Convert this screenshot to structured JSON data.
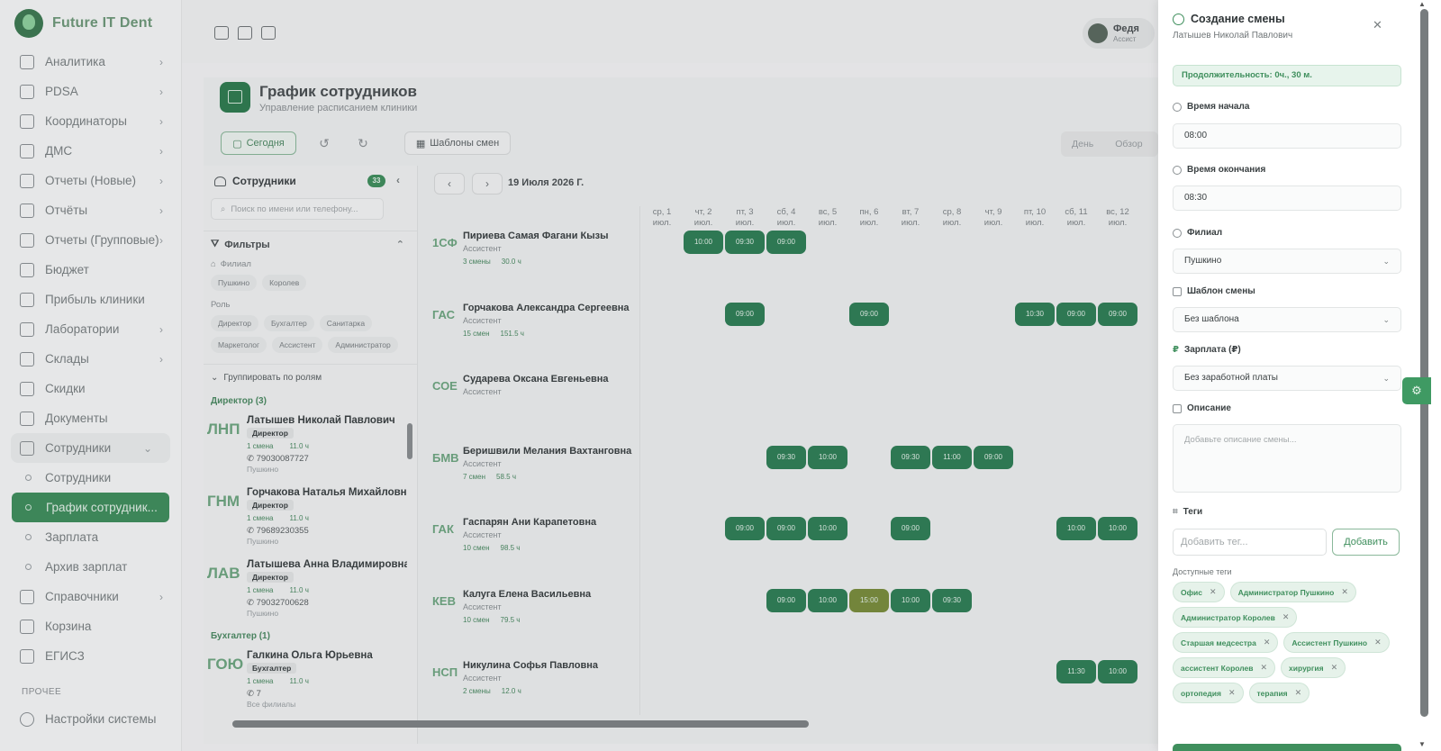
{
  "app": {
    "name": "Future IT Dent"
  },
  "sidebar": {
    "items": [
      {
        "label": "Аналитика",
        "chevron": true
      },
      {
        "label": "PDSA",
        "chevron": true
      },
      {
        "label": "Координаторы",
        "chevron": true
      },
      {
        "label": "ДМС",
        "chevron": true
      },
      {
        "label": "Отчеты (Новые)",
        "chevron": true
      },
      {
        "label": "Отчёты",
        "chevron": true
      },
      {
        "label": "Отчеты (Групповые)",
        "chevron": true
      },
      {
        "label": "Бюджет",
        "chevron": false
      },
      {
        "label": "Прибыль клиники",
        "chevron": false
      },
      {
        "label": "Лаборатории",
        "chevron": true
      },
      {
        "label": "Склады",
        "chevron": true
      },
      {
        "label": "Скидки",
        "chevron": false
      },
      {
        "label": "Документы",
        "chevron": false
      },
      {
        "label": "Сотрудники",
        "chevron": true
      }
    ],
    "sub_items": [
      "Сотрудники",
      "График сотрудник...",
      "Зарплата",
      "Архив зарплат"
    ],
    "items_after": [
      {
        "label": "Справочники",
        "chevron": true
      },
      {
        "label": "Корзина",
        "chevron": false
      },
      {
        "label": "ЕГИСЗ",
        "chevron": false
      }
    ],
    "section_other": "ПРОЧЕЕ",
    "settings_label": "Настройки системы"
  },
  "topbar": {
    "user_name": "Федя",
    "user_role": "Ассист"
  },
  "page": {
    "title": "График сотрудников",
    "subtitle": "Управление расписанием клиники"
  },
  "toolbar": {
    "today": "Сегодня",
    "templates": "Шаблоны смен",
    "view_day": "День",
    "view_overview": "Обзор"
  },
  "employees": {
    "title": "Сотрудники",
    "count": "33",
    "search_placeholder": "Поиск по имени или телефону...",
    "filters_title": "Фильтры",
    "filter_branch_label": "Филиал",
    "branches": [
      "Пушкино",
      "Королев"
    ],
    "filter_role_label": "Роль",
    "roles": [
      "Директор",
      "Бухгалтер",
      "Санитарка",
      "Маркетолог",
      "Ассистент",
      "Администратор"
    ],
    "group_by_roles": "Группировать по ролям",
    "groups": [
      {
        "label": "Директор (3)",
        "people": [
          {
            "initials": "ЛНП",
            "name": "Латышев Николай Павлович",
            "role": "Директор",
            "shifts": "1 смена",
            "hours": "11.0 ч",
            "phone": "79030087727",
            "branch": "Пушкино"
          },
          {
            "initials": "ГНМ",
            "name": "Горчакова Наталья Михайловна",
            "role": "Директор",
            "shifts": "1 смена",
            "hours": "11.0 ч",
            "phone": "79689230355",
            "branch": "Пушкино"
          },
          {
            "initials": "ЛАВ",
            "name": "Латышева Анна Владимировна",
            "role": "Директор",
            "shifts": "1 смена",
            "hours": "11.0 ч",
            "phone": "79032700628",
            "branch": "Пушкино"
          }
        ]
      },
      {
        "label": "Бухгалтер (1)",
        "people": [
          {
            "initials": "ГОЮ",
            "name": "Галкина Ольга Юрьевна",
            "role": "Бухгалтер",
            "shifts": "1 смена",
            "hours": "11.0 ч",
            "phone": "7",
            "branch": "Все филиалы"
          }
        ]
      }
    ]
  },
  "calendar": {
    "date": "19 Июля 2026 Г.",
    "days": [
      {
        "d": "ср, 1",
        "m": "июл."
      },
      {
        "d": "чт, 2",
        "m": "июл."
      },
      {
        "d": "пт, 3",
        "m": "июл."
      },
      {
        "d": "сб, 4",
        "m": "июл."
      },
      {
        "d": "вс, 5",
        "m": "июл."
      },
      {
        "d": "пн, 6",
        "m": "июл."
      },
      {
        "d": "вт, 7",
        "m": "июл."
      },
      {
        "d": "ср, 8",
        "m": "июл."
      },
      {
        "d": "чт, 9",
        "m": "июл."
      },
      {
        "d": "пт, 10",
        "m": "июл."
      },
      {
        "d": "сб, 11",
        "m": "июл."
      },
      {
        "d": "вс, 12",
        "m": "июл."
      }
    ],
    "rows": [
      {
        "initials": "1СФ",
        "name": "Пириева Самая Фагани Кызы",
        "role": "Ассистент",
        "shifts": "3 смены",
        "hours": "30.0 ч",
        "entries": [
          {
            "day": 1,
            "time": "10:00"
          },
          {
            "day": 2,
            "time": "09:30"
          },
          {
            "day": 3,
            "time": "09:00"
          }
        ]
      },
      {
        "initials": "ГАС",
        "name": "Горчакова Александра Сергеевна",
        "role": "Ассистент",
        "shifts": "15 смен",
        "hours": "151.5 ч",
        "entries": [
          {
            "day": 2,
            "time": "09:00"
          },
          {
            "day": 5,
            "time": "09:00"
          },
          {
            "day": 9,
            "time": "10:30"
          },
          {
            "day": 10,
            "time": "09:00"
          },
          {
            "day": 11,
            "time": "09:00"
          }
        ]
      },
      {
        "initials": "СОЕ",
        "name": "Сударева Оксана Евгеньевна",
        "role": "Ассистент",
        "shifts": "",
        "hours": "",
        "entries": []
      },
      {
        "initials": "БМВ",
        "name": "Беришвили Мелания Вахтанговна",
        "role": "Ассистент",
        "shifts": "7 смен",
        "hours": "58.5 ч",
        "entries": [
          {
            "day": 3,
            "time": "09:30"
          },
          {
            "day": 4,
            "time": "10:00"
          },
          {
            "day": 6,
            "time": "09:30"
          },
          {
            "day": 7,
            "time": "11:00"
          },
          {
            "day": 8,
            "time": "09:00"
          }
        ]
      },
      {
        "initials": "ГАК",
        "name": "Гаспарян Ани Карапетовна",
        "role": "Ассистент",
        "shifts": "10 смен",
        "hours": "98.5 ч",
        "entries": [
          {
            "day": 2,
            "time": "09:00"
          },
          {
            "day": 3,
            "time": "09:00"
          },
          {
            "day": 4,
            "time": "10:00"
          },
          {
            "day": 6,
            "time": "09:00"
          },
          {
            "day": 10,
            "time": "10:00"
          },
          {
            "day": 11,
            "time": "10:00"
          }
        ]
      },
      {
        "initials": "КЕВ",
        "name": "Калуга Елена Васильевна",
        "role": "Ассистент",
        "shifts": "10 смен",
        "hours": "79.5 ч",
        "entries": [
          {
            "day": 3,
            "time": "09:00"
          },
          {
            "day": 4,
            "time": "10:00"
          },
          {
            "day": 5,
            "time": "15:00",
            "warn": true
          },
          {
            "day": 6,
            "time": "10:00"
          },
          {
            "day": 7,
            "time": "09:30"
          }
        ]
      },
      {
        "initials": "НСП",
        "name": "Никулина Софья Павловна",
        "role": "Ассистент",
        "shifts": "2 смены",
        "hours": "12.0 ч",
        "entries": [
          {
            "day": 10,
            "time": "11:30"
          },
          {
            "day": 11,
            "time": "10:00"
          }
        ]
      }
    ]
  },
  "drawer": {
    "title": "Создание смены",
    "subtitle": "Латышев Николай Павлович",
    "duration": "Продолжительность: 0ч., 30 м.",
    "start_label": "Время начала",
    "start_value": "08:00",
    "end_label": "Время окончания",
    "end_value": "08:30",
    "branch_label": "Филиал",
    "branch_value": "Пушкино",
    "template_label": "Шаблон смены",
    "template_value": "Без шаблона",
    "salary_label": "Зарплата (₽)",
    "salary_value": "Без заработной платы",
    "description_label": "Описание",
    "description_placeholder": "Добавьте описание смены...",
    "tags_label": "Теги",
    "tag_input_placeholder": "Добавить тег...",
    "add_button": "Добавить",
    "available_tags_label": "Доступные теги",
    "tags": [
      "Офис",
      "Администратор Пушкино",
      "Администратор Королев",
      "Старшая медсестра",
      "Ассистент Пушкино",
      "ассистент Королев",
      "хирургия",
      "ортопедия",
      "терапия"
    ]
  },
  "icons": {
    "close": "close-icon",
    "chevron": "chevron-right-icon",
    "gear": "gear-icon"
  },
  "colors": {
    "accent": "#3f8f5d",
    "shift": "#2f7f56",
    "shift_warn": "#7a8e3c"
  }
}
